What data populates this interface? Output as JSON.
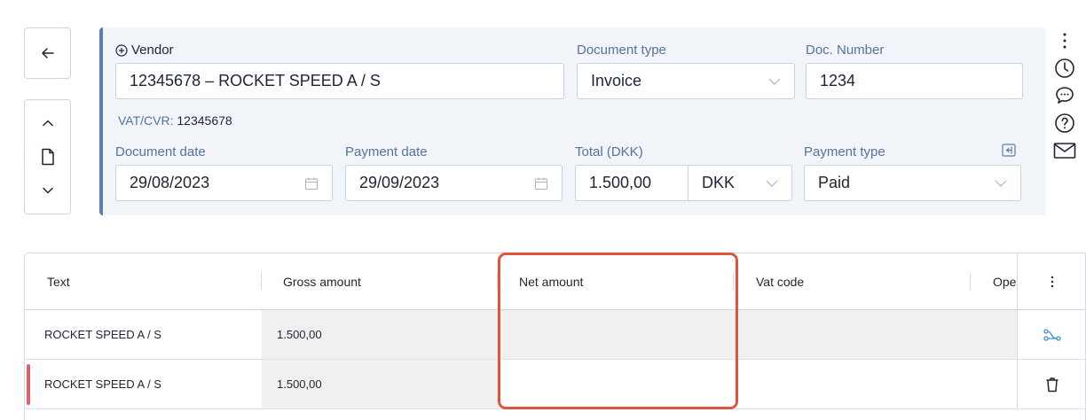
{
  "header": {
    "vendor_label": "Vendor",
    "vendor_value": "12345678 – ROCKET SPEED A / S",
    "document_type_label": "Document type",
    "document_type_value": "Invoice",
    "doc_number_label": "Doc. Number",
    "doc_number_value": "1234",
    "vat_label": "VAT/CVR:",
    "vat_value": "12345678",
    "document_date_label": "Document date",
    "document_date_value": "29/08/2023",
    "payment_date_label": "Payment date",
    "payment_date_value": "29/09/2023",
    "total_label": "Total (DKK)",
    "total_value": "1.500,00",
    "currency_value": "DKK",
    "payment_type_label": "Payment type",
    "payment_type_value": "Paid"
  },
  "table": {
    "columns": [
      "Text",
      "Gross amount",
      "Net amount",
      "Vat code",
      "Ope"
    ],
    "rows": [
      {
        "text": "ROCKET SPEED A / S",
        "gross": "1.500,00",
        "net": "",
        "vat_code": "",
        "action_icon": "split-icon"
      },
      {
        "text": "ROCKET SPEED A / S",
        "gross": "1.500,00",
        "net": "",
        "vat_code": "",
        "action_icon": "trash-icon"
      }
    ]
  },
  "colors": {
    "accent_blue": "#5a7fac",
    "panel_bg": "#f1f5fa",
    "highlight": "#e2533d",
    "row_marker": "#e0606a",
    "split_icon": "#3a8fd6"
  }
}
